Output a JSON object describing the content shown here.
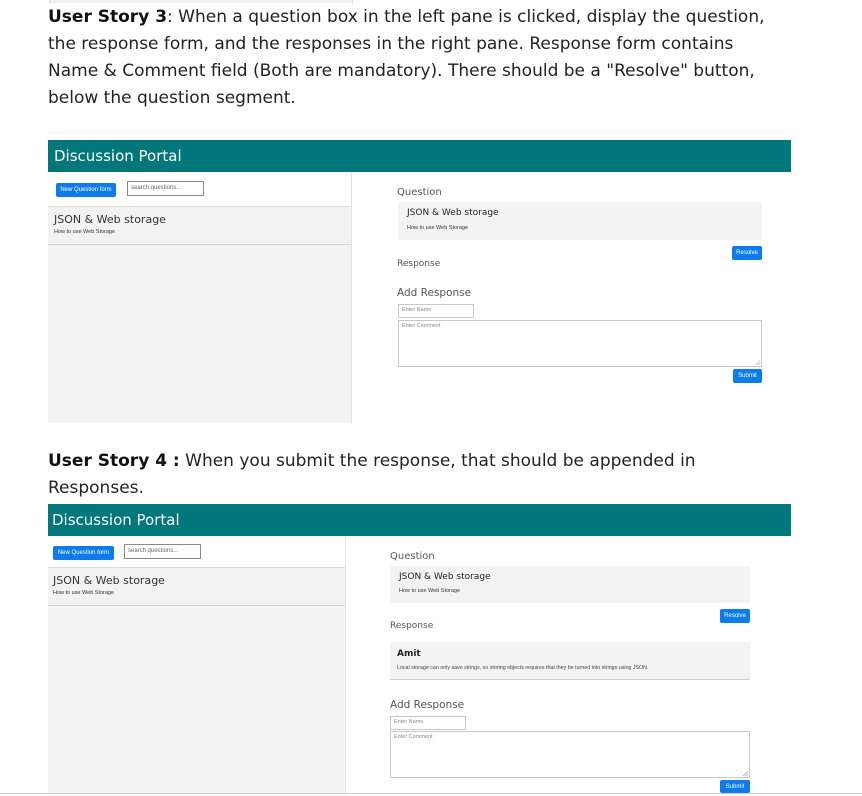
{
  "story3": {
    "label": "User Story 3",
    "text": ": When a question box in the left pane is clicked, display the question, the response form, and the responses in the right pane. Response form contains Name & Comment field (Both are mandatory). There should be a \"Resolve\" button, below the question segment."
  },
  "story4": {
    "label": "User Story 4 :",
    "text": " When you submit the response, that should be appended in Responses."
  },
  "portal": {
    "title": "Discussion Portal",
    "new_question_button": "New Question form",
    "search_placeholder": "search questions...",
    "question_item": {
      "title": "JSON & Web storage",
      "subtitle": "How to use Web Storage"
    },
    "question_label": "Question",
    "question_title": "JSON & Web storage",
    "question_subtitle": "How to use Web Storage",
    "resolve_button": "Resolve",
    "response_label": "Response",
    "add_response_label": "Add Response",
    "name_placeholder": "Enter Name",
    "comment_placeholder": "Enter Comment",
    "submit_button": "Submit"
  },
  "response_entry": {
    "name": "Amit",
    "comment": "Local storage can only save strings, so storing objects requires that they be turned into strings using JSON."
  },
  "colors": {
    "header": "#00777a",
    "button": "#0d7bec"
  }
}
